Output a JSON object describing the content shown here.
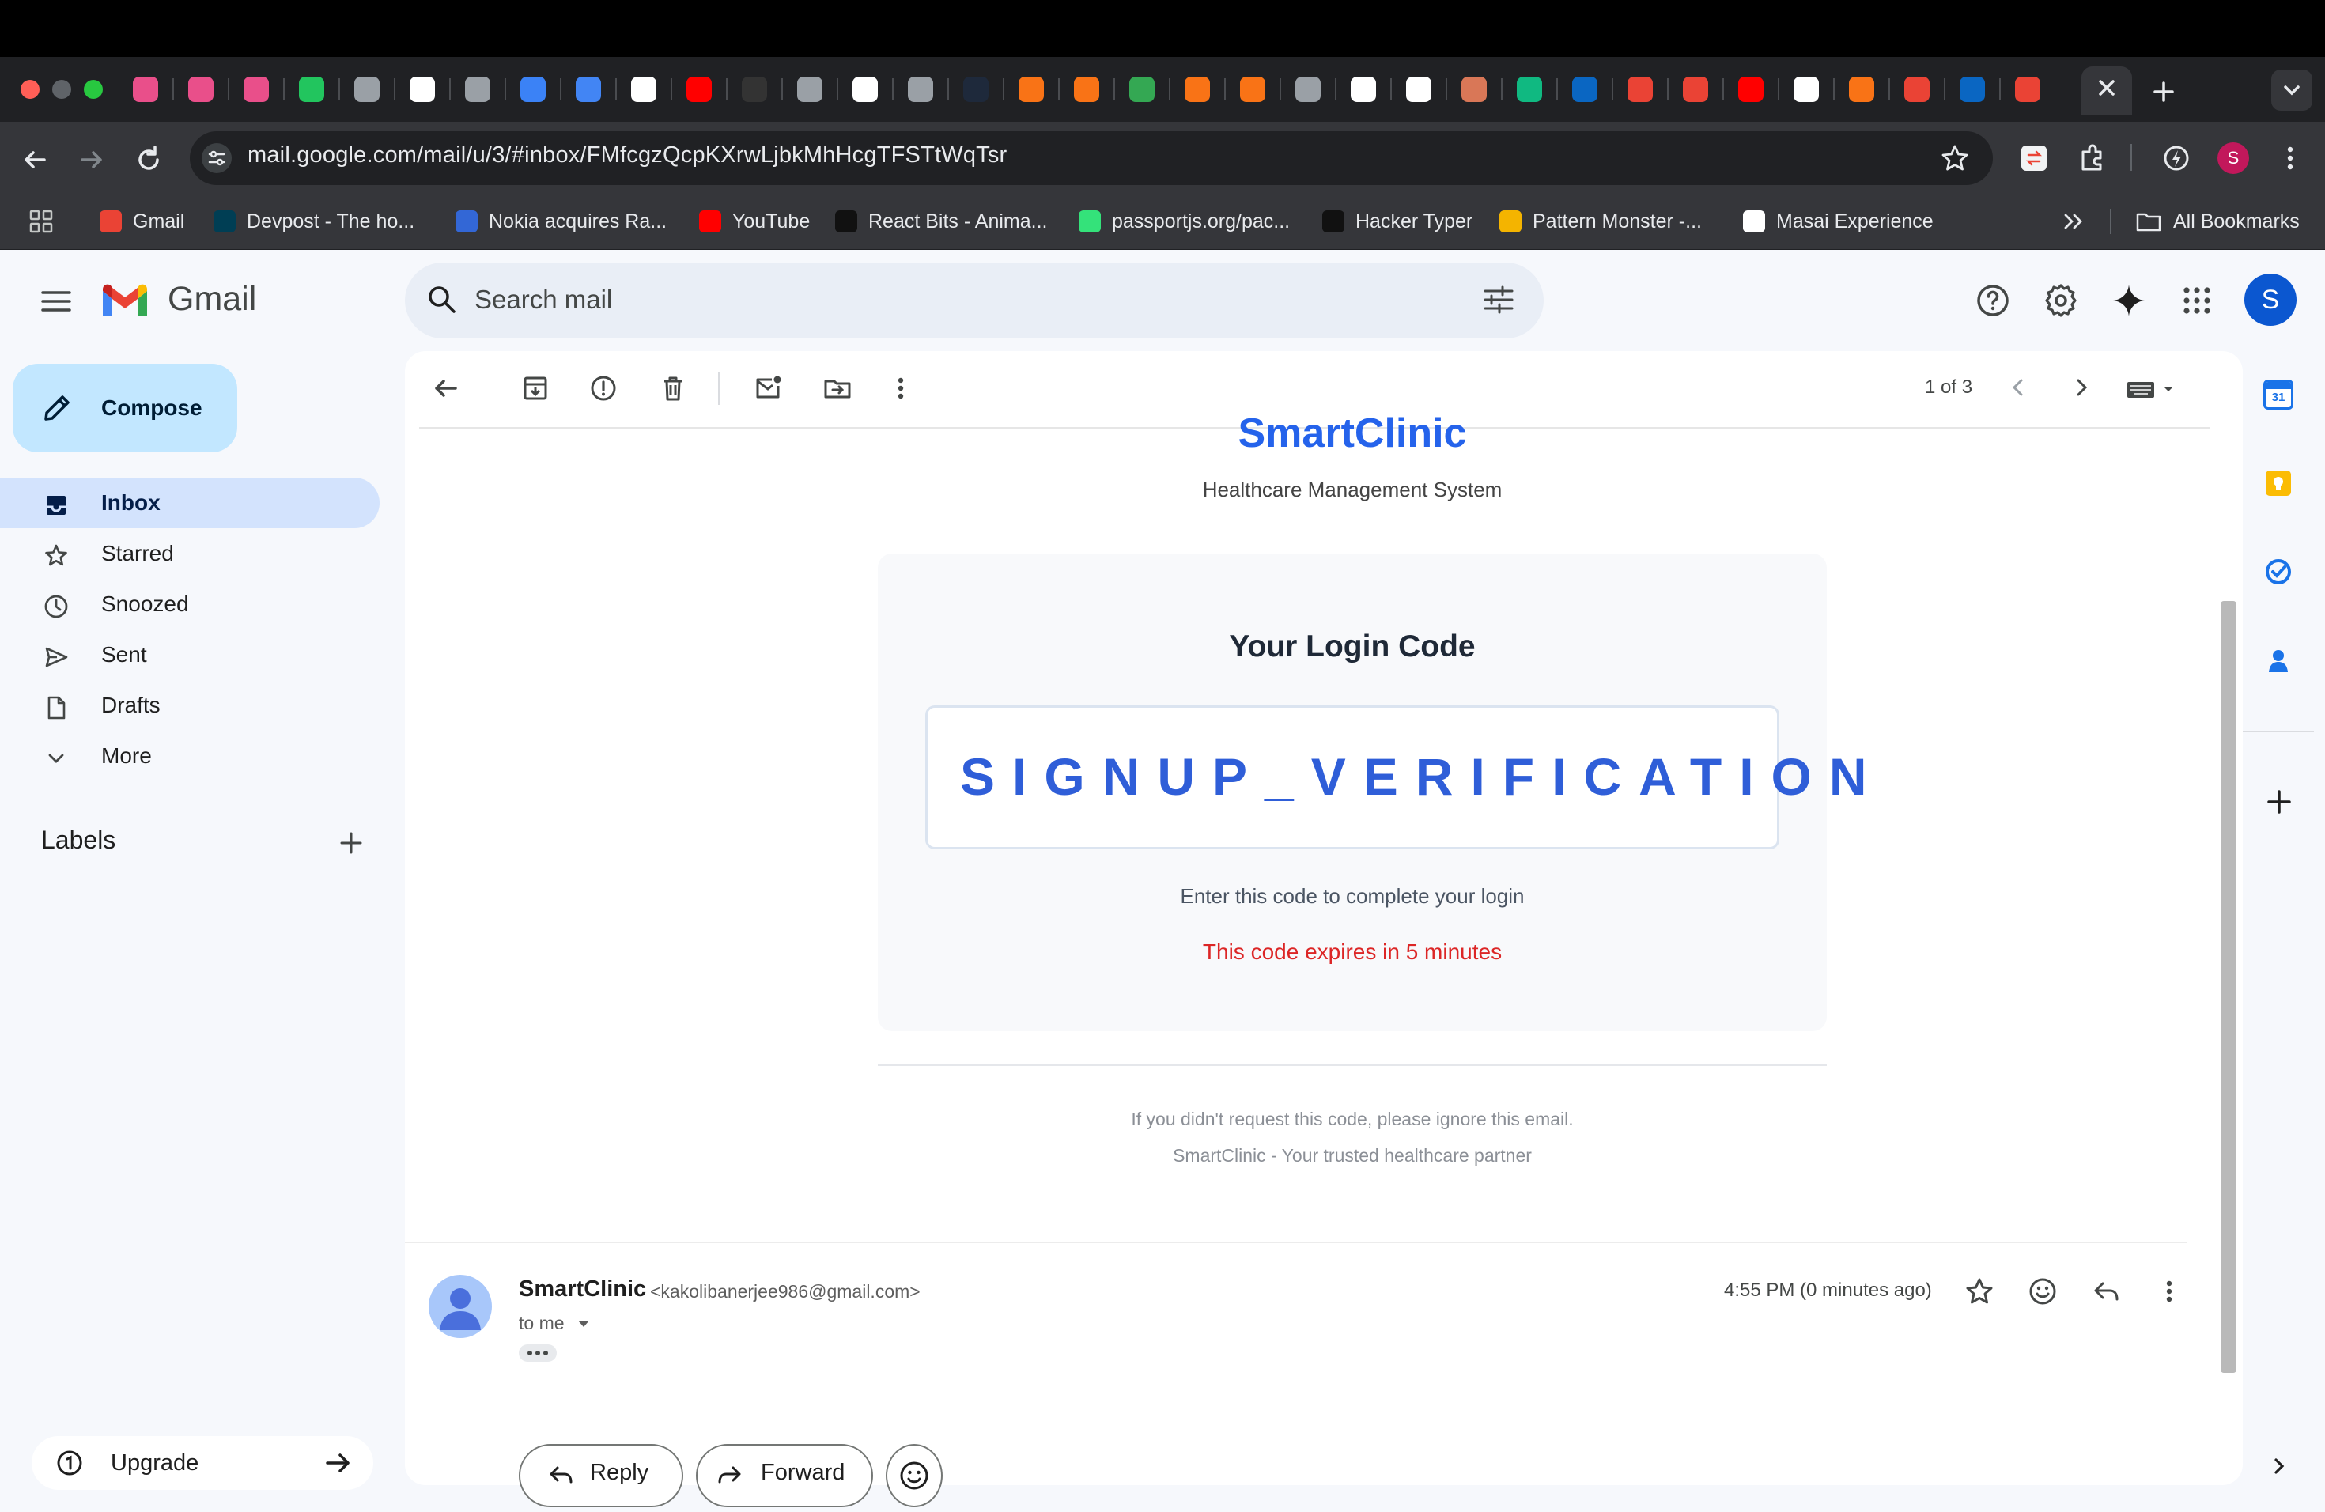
{
  "browser": {
    "url": "mail.google.com/mail/u/3/#inbox/FMfcgzQcpKXrwLjbkMhHcgTFSTtWqTsr",
    "profile_initial": "S",
    "bookmarks": [
      {
        "label": "Gmail",
        "color": "#ea4335"
      },
      {
        "label": "Devpost - The ho...",
        "color": "#003e54"
      },
      {
        "label": "Nokia acquires Ra...",
        "color": "#3367d6"
      },
      {
        "label": "YouTube",
        "color": "#ff0000"
      },
      {
        "label": "React Bits - Anima...",
        "color": "#111111"
      },
      {
        "label": "passportjs.org/pac...",
        "color": "#34e27a"
      },
      {
        "label": "Hacker Typer",
        "color": "#111111"
      },
      {
        "label": "Pattern Monster -...",
        "color": "#f4b400"
      },
      {
        "label": "Masai Experience",
        "color": "#ffffff"
      }
    ],
    "all_bookmarks": "All Bookmarks",
    "tab_favicon_colors": [
      "#e94f8a",
      "#e94f8a",
      "#e94f8a",
      "#22c55e",
      "#9aa0a6",
      "#ffffff",
      "#9aa0a6",
      "#3b82f6",
      "#4285f4",
      "#ffffff",
      "#ff0000",
      "#333333",
      "#9aa0a6",
      "#ffffff",
      "#9aa0a6",
      "#1e293b",
      "#f97316",
      "#f97316",
      "#34a853",
      "#f97316",
      "#f97316",
      "#9aa0a6",
      "#ffffff",
      "#ffffff",
      "#d97757",
      "#10b981",
      "#0a66c2",
      "#ea4335",
      "#ea4335",
      "#ff0000",
      "#ffffff",
      "#f97316",
      "#ea4335",
      "#0a66c2",
      "#ea4335"
    ]
  },
  "gmail": {
    "app_name": "Gmail",
    "search_placeholder": "Search mail",
    "compose": "Compose",
    "nav": [
      {
        "label": "Inbox",
        "icon": "inbox-icon",
        "active": true
      },
      {
        "label": "Starred",
        "icon": "star-icon"
      },
      {
        "label": "Snoozed",
        "icon": "clock-icon"
      },
      {
        "label": "Sent",
        "icon": "send-icon"
      },
      {
        "label": "Drafts",
        "icon": "draft-icon"
      },
      {
        "label": "More",
        "icon": "chevron-down-icon"
      }
    ],
    "labels_header": "Labels",
    "upgrade": "Upgrade",
    "avatar_initial": "S",
    "pager": "1 of 3"
  },
  "email": {
    "brand": "SmartClinic",
    "brand_subtitle": "Healthcare Management System",
    "card_title": "Your Login Code",
    "code": "SIGNUP_VERIFICATION",
    "instruction": "Enter this code to complete your login",
    "expiry": "This code expires in 5 minutes",
    "footer_line1": "If you didn't request this code, please ignore this email.",
    "footer_line2": "SmartClinic - Your trusted healthcare partner",
    "accent_color": "#2563eb",
    "expiry_color": "#dc2626"
  },
  "message": {
    "sender_name": "SmartClinic",
    "sender_email": "<kakolibanerjee986@gmail.com>",
    "recipient": "to me",
    "timestamp": "4:55 PM (0 minutes ago)",
    "reply": "Reply",
    "forward": "Forward"
  }
}
